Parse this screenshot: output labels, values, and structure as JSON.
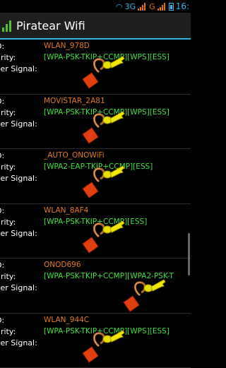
{
  "statusbar": {
    "net1": "3G",
    "net2": "G",
    "time": "16:"
  },
  "app": {
    "title": "Piratear Wifi"
  },
  "labels": {
    "ssid": "D:",
    "security": "urity:",
    "power": "ver Signal:"
  },
  "networks": [
    {
      "ssid": "WLAN_978D",
      "security": "[WPA-PSK-TKIP+CCMP][WPS][ESS]"
    },
    {
      "ssid": "MOVISTAR_2A81",
      "security": "[WPA-PSK-TKIP+CCMP][WPS][ESS]"
    },
    {
      "ssid": "_AUTO_ONOWiFi",
      "security": "[WPA2-EAP-TKIP+CCMP][ESS]"
    },
    {
      "ssid": "WLAN_8AF4",
      "security": "[WPA-PSK-TKIP+CCMP][ESS]"
    },
    {
      "ssid": "ONOD696",
      "security": "[WPA-PSK-TKIP+CCMP][WPA2-PSK-T"
    },
    {
      "ssid": "WLAN_944C",
      "security": "[WPA-PSK-TKIP+CCMP][WPS][ESS]"
    }
  ],
  "colors": {
    "ssid": "#e07a1e",
    "security": "#3ee03e",
    "accent": "#33b5e5"
  }
}
